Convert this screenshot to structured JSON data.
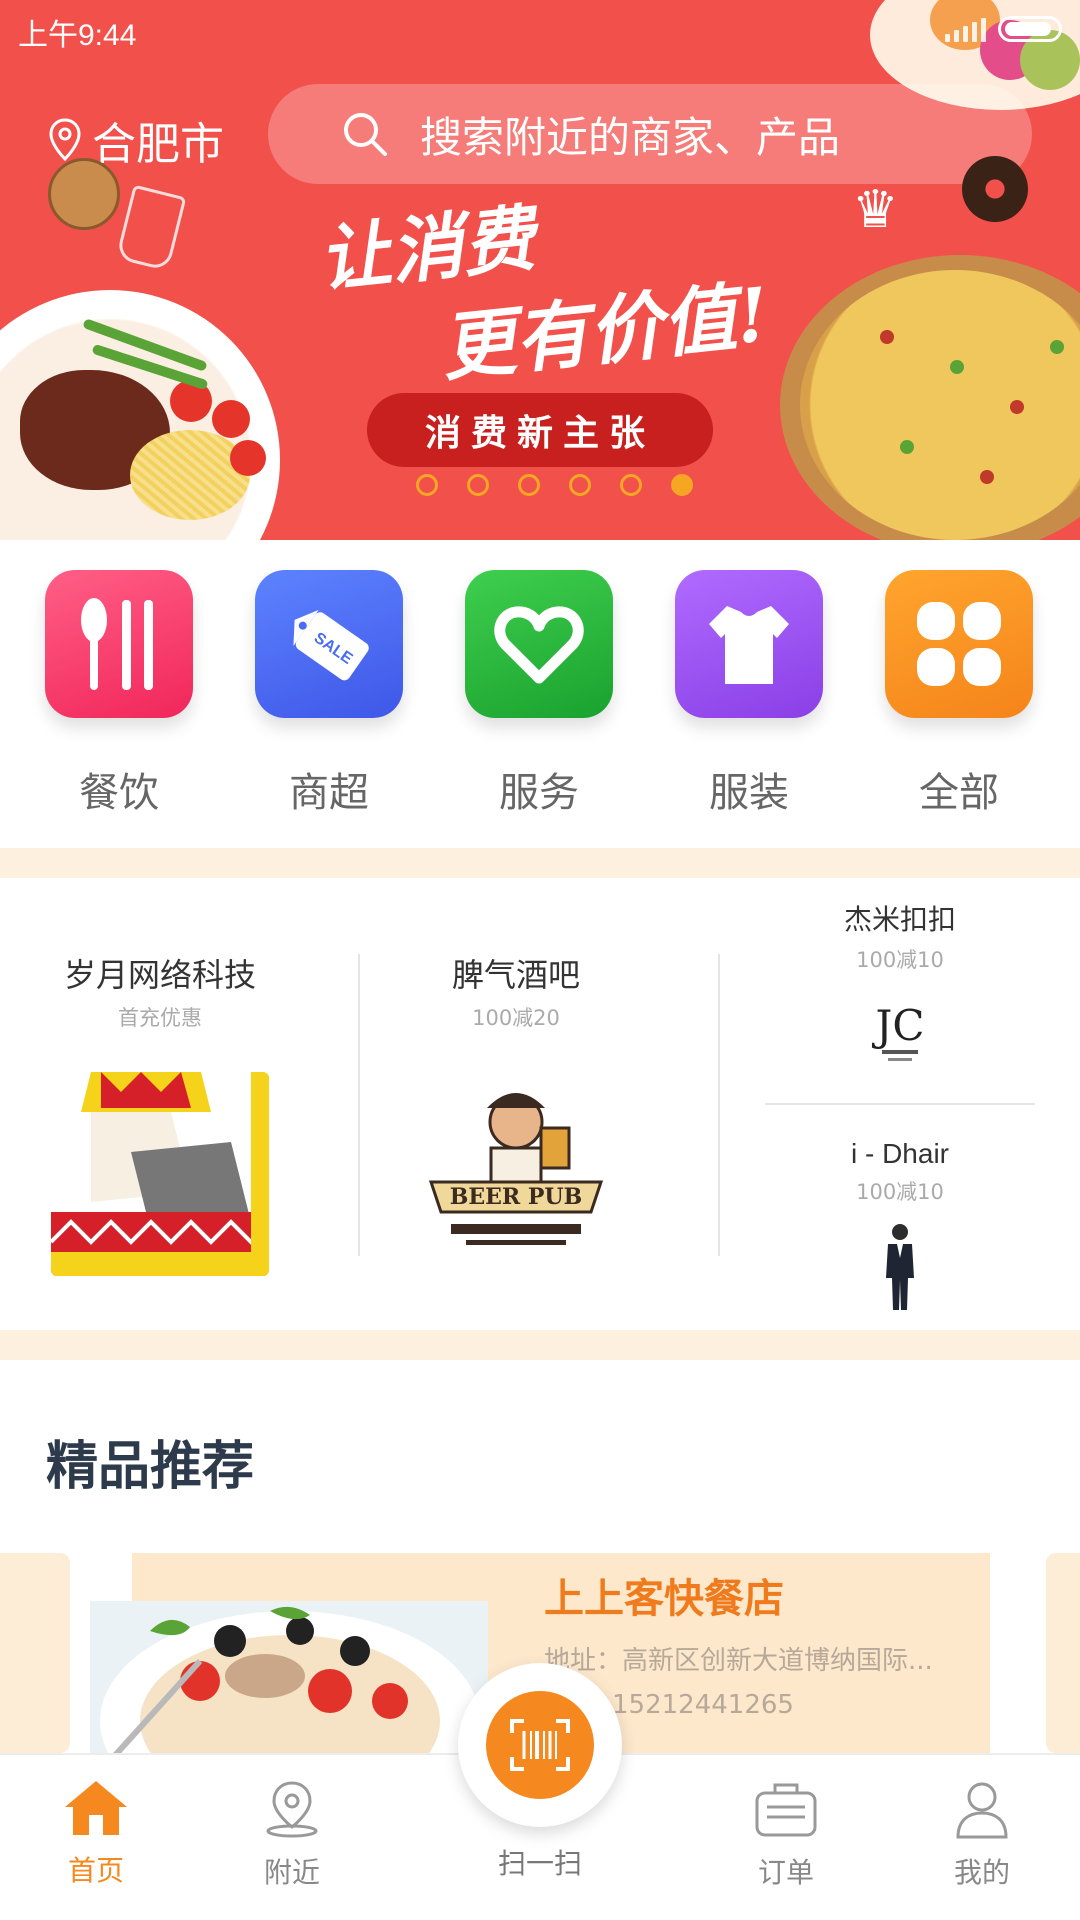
{
  "status_bar": {
    "time": "上午9:44"
  },
  "header": {
    "city": "合肥市",
    "search_placeholder": "搜索附近的商家、产品"
  },
  "banner": {
    "slogan_line1": "让消费",
    "slogan_line2": "更有价值!",
    "tag": "消费新主张",
    "dots_total": 6,
    "dots_active_index": 5,
    "accent_color": "#f2504b"
  },
  "categories": [
    {
      "label": "餐饮",
      "icon": "utensils-icon",
      "color": "#f33b6b"
    },
    {
      "label": "商超",
      "icon": "sale-tag-icon",
      "color": "#4a6cf2"
    },
    {
      "label": "服务",
      "icon": "heart-icon",
      "color": "#23b53a"
    },
    {
      "label": "服装",
      "icon": "shirt-icon",
      "color": "#9b50ea"
    },
    {
      "label": "全部",
      "icon": "grid-icon",
      "color": "#f7941d"
    }
  ],
  "stores": [
    {
      "name": "岁月网络科技",
      "deal": "首充优惠",
      "logo": "playing-card-king-logo"
    },
    {
      "name": "脾气酒吧",
      "deal": "100减20",
      "logo": "beer-pub-logo",
      "logo_text": "BEER PUB"
    },
    {
      "name": "杰米扣扣",
      "deal": "100减10",
      "logo": "jc-logo",
      "logo_text": "JC"
    },
    {
      "name": "i - Dhair",
      "deal": "100减10",
      "logo": "man-in-suit-logo"
    }
  ],
  "recommend": {
    "title": "精品推荐",
    "card": {
      "name": "上上客快餐店",
      "address": "地址：高新区创新大道博纳国际...",
      "phone": "15212441265"
    }
  },
  "tabbar": {
    "items": [
      {
        "label": "首页",
        "icon": "home-icon",
        "active": true
      },
      {
        "label": "附近",
        "icon": "location-pin-icon",
        "active": false
      },
      {
        "label": "扫一扫",
        "icon": "scan-icon",
        "active": false
      },
      {
        "label": "订单",
        "icon": "order-icon",
        "active": false
      },
      {
        "label": "我的",
        "icon": "user-icon",
        "active": false
      }
    ],
    "active_color": "#f5891f"
  }
}
